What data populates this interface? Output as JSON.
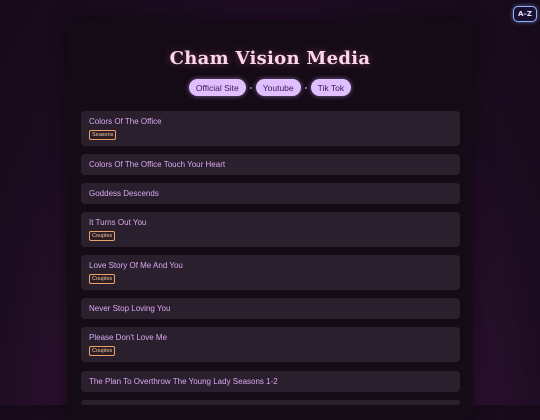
{
  "sort_button": {
    "label": "A–Z"
  },
  "header": {
    "title": "Cham Vision Media"
  },
  "links": [
    {
      "label": "Official Site"
    },
    {
      "label": "Youtube"
    },
    {
      "label": "Tik Tok"
    }
  ],
  "items": [
    {
      "title": "Colors Of The Office",
      "tag": "Seasons"
    },
    {
      "title": "Colors Of The Office Touch Your Heart",
      "tag": null
    },
    {
      "title": "Goddess Descends",
      "tag": null
    },
    {
      "title": "It Turns Out You",
      "tag": "Couples"
    },
    {
      "title": "Love Story Of Me And You",
      "tag": "Couples"
    },
    {
      "title": "Never Stop Loving You",
      "tag": null
    },
    {
      "title": "Please Don't Love Me",
      "tag": "Couples"
    },
    {
      "title": "The Plan To Overthrow The Young Lady Seasons 1-2",
      "tag": null
    }
  ]
}
